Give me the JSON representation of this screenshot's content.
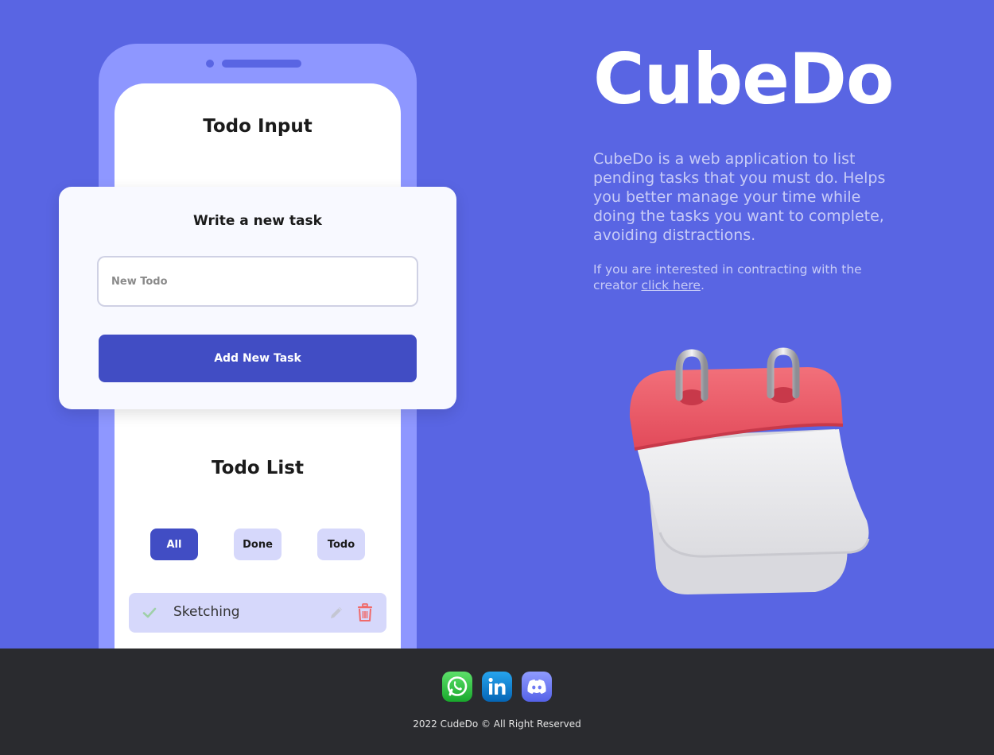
{
  "colors": {
    "background": "#5965e3",
    "phone_frame": "#8e97ff",
    "primary_button": "#414dc4",
    "secondary_button": "#d6d8fb",
    "footer": "#2a2b2f"
  },
  "phone": {
    "input_title": "Todo Input",
    "list_title": "Todo List",
    "filters": [
      {
        "label": "All",
        "active": true
      },
      {
        "label": "Done",
        "active": false
      },
      {
        "label": "Todo",
        "active": false
      }
    ],
    "todos": [
      {
        "text": "Sketching",
        "done": true,
        "icons": [
          "check-icon",
          "pencil-icon",
          "trash-icon"
        ]
      }
    ]
  },
  "card": {
    "title": "Write a new task",
    "input_placeholder": "New Todo",
    "input_value": "",
    "button_label": "Add New Task"
  },
  "hero": {
    "brand": "CubeDo",
    "description": "CubeDo is a web application to list pending tasks that you must do. Helps you better manage your time while doing the tasks you want to complete, avoiding distractions.",
    "contact_prefix": "If you are interested in contracting with the creator ",
    "contact_link": "click here",
    "contact_suffix": ".",
    "illustration": "calendar-icon"
  },
  "footer": {
    "socials": [
      "whatsapp-icon",
      "linkedin-icon",
      "discord-icon"
    ],
    "copyright": "2022 CudeDo © All Right Reserved"
  }
}
